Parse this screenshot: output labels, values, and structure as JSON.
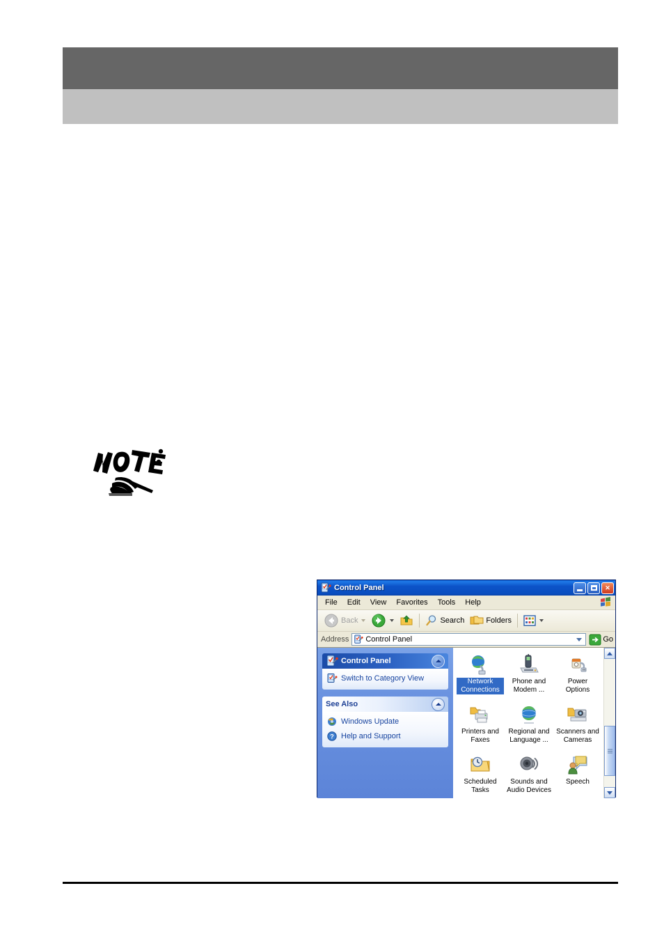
{
  "page": {
    "banners": [
      {
        "name": "header-bar-dark",
        "color": "#666666",
        "text": ""
      },
      {
        "name": "header-bar-light",
        "color": "#c0c0c0",
        "text": ""
      }
    ],
    "note_marker": {
      "label": "NOTE:",
      "text": ""
    },
    "footer_rule": {
      "color": "#000000"
    }
  },
  "window": {
    "title": "Control Panel",
    "title_icon": "control-panel-icon",
    "controls": {
      "minimize": "Minimize",
      "maximize": "Maximize",
      "close": "Close"
    },
    "menu": [
      {
        "label": "File"
      },
      {
        "label": "Edit"
      },
      {
        "label": "View"
      },
      {
        "label": "Favorites"
      },
      {
        "label": "Tools"
      },
      {
        "label": "Help"
      }
    ],
    "toolbar": {
      "back": "Back",
      "search": "Search",
      "folders": "Folders"
    },
    "address": {
      "label": "Address",
      "value": "Control Panel",
      "go": "Go"
    },
    "task_pane": {
      "groups": [
        {
          "title": "Control Panel",
          "icon": "control-panel-icon",
          "style": "blue",
          "links": [
            {
              "label": "Switch to Category View",
              "icon": "category-view-icon"
            }
          ]
        },
        {
          "title": "See Also",
          "icon": "",
          "style": "pale",
          "links": [
            {
              "label": "Windows Update",
              "icon": "windows-update-icon"
            },
            {
              "label": "Help and Support",
              "icon": "help-support-icon"
            }
          ]
        }
      ]
    },
    "items": [
      {
        "label": "Network Connections",
        "icon": "network-connections-icon",
        "selected": true
      },
      {
        "label": "Phone and Modem ...",
        "icon": "phone-and-modem-icon",
        "selected": false
      },
      {
        "label": "Power Options",
        "icon": "power-options-icon",
        "selected": false
      },
      {
        "label": "Printers and Faxes",
        "icon": "printers-and-faxes-icon",
        "selected": false
      },
      {
        "label": "Regional and Language ...",
        "icon": "regional-and-language-icon",
        "selected": false
      },
      {
        "label": "Scanners and Cameras",
        "icon": "scanners-and-cameras-icon",
        "selected": false
      },
      {
        "label": "Scheduled Tasks",
        "icon": "scheduled-tasks-icon",
        "selected": false
      },
      {
        "label": "Sounds and Audio Devices",
        "icon": "sounds-and-audio-devices-icon",
        "selected": false
      },
      {
        "label": "Speech",
        "icon": "speech-icon",
        "selected": false
      }
    ]
  },
  "colors": {
    "title_blue": "#0a53c8",
    "selection_blue": "#316ac5",
    "task_pane_blue": "#6b93e0",
    "window_chrome": "#ece9d8",
    "banner_dark": "#666666",
    "banner_light": "#c0c0c0"
  }
}
